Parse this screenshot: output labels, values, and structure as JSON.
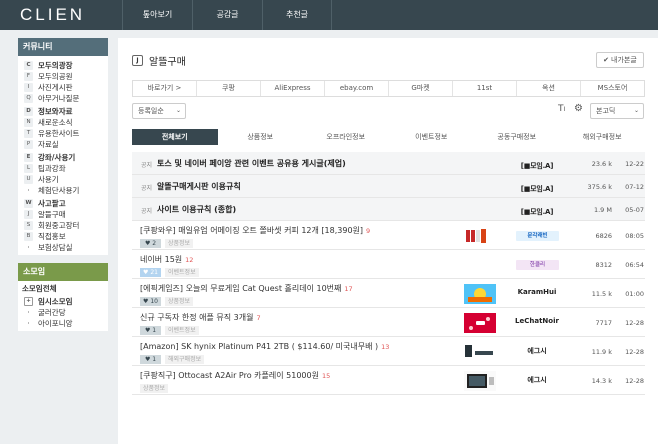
{
  "header": {
    "logo": "CLIEN",
    "nav": [
      "톺아보기",
      "공감글",
      "추천글"
    ]
  },
  "sidebar": {
    "community": {
      "title": "커뮤니티",
      "color": "#546e7a",
      "items": [
        {
          "key": "C",
          "label": "모두의광장",
          "header": true
        },
        {
          "key": "F",
          "label": "모두의공원"
        },
        {
          "key": "I",
          "label": "사진게시판"
        },
        {
          "key": "Q",
          "label": "아무거나질문"
        },
        {
          "key": "D",
          "label": "정보와자료",
          "header": true
        },
        {
          "key": "N",
          "label": "새로운소식"
        },
        {
          "key": "T",
          "label": "유용한사이트"
        },
        {
          "key": "P",
          "label": "자료실"
        },
        {
          "key": "E",
          "label": "강좌/사용기",
          "header": true
        },
        {
          "key": "L",
          "label": "팁과강좌"
        },
        {
          "key": "U",
          "label": "사용기"
        },
        {
          "key": "·",
          "label": "체험단사용기",
          "dot": true
        },
        {
          "key": "W",
          "label": "사고팔고",
          "header": true
        },
        {
          "key": "J",
          "label": "알뜰구매"
        },
        {
          "key": "S",
          "label": "회원중고장터"
        },
        {
          "key": "B",
          "label": "직접홍보"
        },
        {
          "key": "·",
          "label": "보험상담실",
          "dot": true
        }
      ]
    },
    "somoim": {
      "title": "소모임",
      "color": "#7a9a4a",
      "items": [
        {
          "key": "",
          "label": "소모임전체",
          "plain": true
        },
        {
          "key": "+",
          "label": "임시소모임",
          "plus": true,
          "header": true
        },
        {
          "key": "·",
          "label": "굴러간당",
          "dot": true
        },
        {
          "key": "·",
          "label": "아이포니앙",
          "dot": true
        }
      ]
    }
  },
  "board": {
    "key": "J",
    "title": "알뜰구매",
    "my_posts": "내가본글"
  },
  "filters": [
    "바로가기 >",
    "쿠팡",
    "AliExpress",
    "ebay.com",
    "G마켓",
    "11st",
    "옥션",
    "MS스토어"
  ],
  "sort": {
    "value": "등록일순"
  },
  "font_select": {
    "value": "본고딕"
  },
  "tabs": [
    {
      "label": "전체보기",
      "active": true
    },
    {
      "label": "상품정보"
    },
    {
      "label": "오프라인정보"
    },
    {
      "label": "이벤트정보"
    },
    {
      "label": "공동구매정보"
    },
    {
      "label": "해외구매정보"
    }
  ],
  "announcements": [
    {
      "label": "공지",
      "title": "토스 및 네이버 페이앙 관련 이벤트 공유용 게시글(제업)",
      "author": "[■모임.A]",
      "hits": "23.6 k",
      "time": "12-22"
    },
    {
      "label": "공지",
      "title": "알뜰구매게시판 이용규칙",
      "author": "[■모임.A]",
      "hits": "375.6 k",
      "time": "07-12"
    },
    {
      "label": "공지",
      "title": "사이트 이용규칙 (종합)",
      "author": "[■모임.A]",
      "hits": "1.9 M",
      "time": "05-07"
    }
  ],
  "posts": [
    {
      "title": "[쿠팡와우] 매일유업 어메이징 오트 쫄바셋 커피 12개 [18,390원]",
      "comments": "9",
      "likes": "2",
      "category": "상품정보",
      "author": "문각래빈",
      "author_style": "logo",
      "hits": "6826",
      "time": "08:05",
      "thumb": "coffee",
      "liked_blue": false
    },
    {
      "title": "네이버 15원",
      "comments": "12",
      "likes": "21",
      "category": "이벤트정보",
      "author": "한클리",
      "author_style": "badge",
      "hits": "8312",
      "time": "06:54",
      "thumb": "none",
      "liked_blue": true
    },
    {
      "title": "[에픽게임즈] 오늘의 무료게임 Cat Quest 홀리데이 10번째",
      "comments": "17",
      "likes": "10",
      "category": "상품정보",
      "author": "KaramHui",
      "author_style": "text",
      "hits": "11.5 k",
      "time": "01:00",
      "thumb": "game",
      "liked_blue": false
    },
    {
      "title": "신규 구독자 한정 애플 뮤직 3개월",
      "comments": "7",
      "likes": "1",
      "category": "이벤트정보",
      "author": "LeChatNoir",
      "author_style": "text",
      "hits": "7717",
      "time": "12-28",
      "thumb": "music",
      "liked_blue": false
    },
    {
      "title": "[Amazon] SK hynix Platinum P41 2TB ( $114.60/ 미국내무배 )",
      "comments": "13",
      "likes": "1",
      "category": "해외구매정보",
      "author": "에그시",
      "author_style": "text",
      "hits": "11.9 k",
      "time": "12-28",
      "thumb": "ssd",
      "liked_blue": false
    },
    {
      "title": "[쿠팡직구] Ottocast A2Air Pro 카플레이 51000원",
      "comments": "15",
      "likes": "",
      "category": "상품정보",
      "author": "에그시",
      "author_style": "text",
      "hits": "14.3 k",
      "time": "12-28",
      "thumb": "car",
      "liked_blue": false
    }
  ]
}
